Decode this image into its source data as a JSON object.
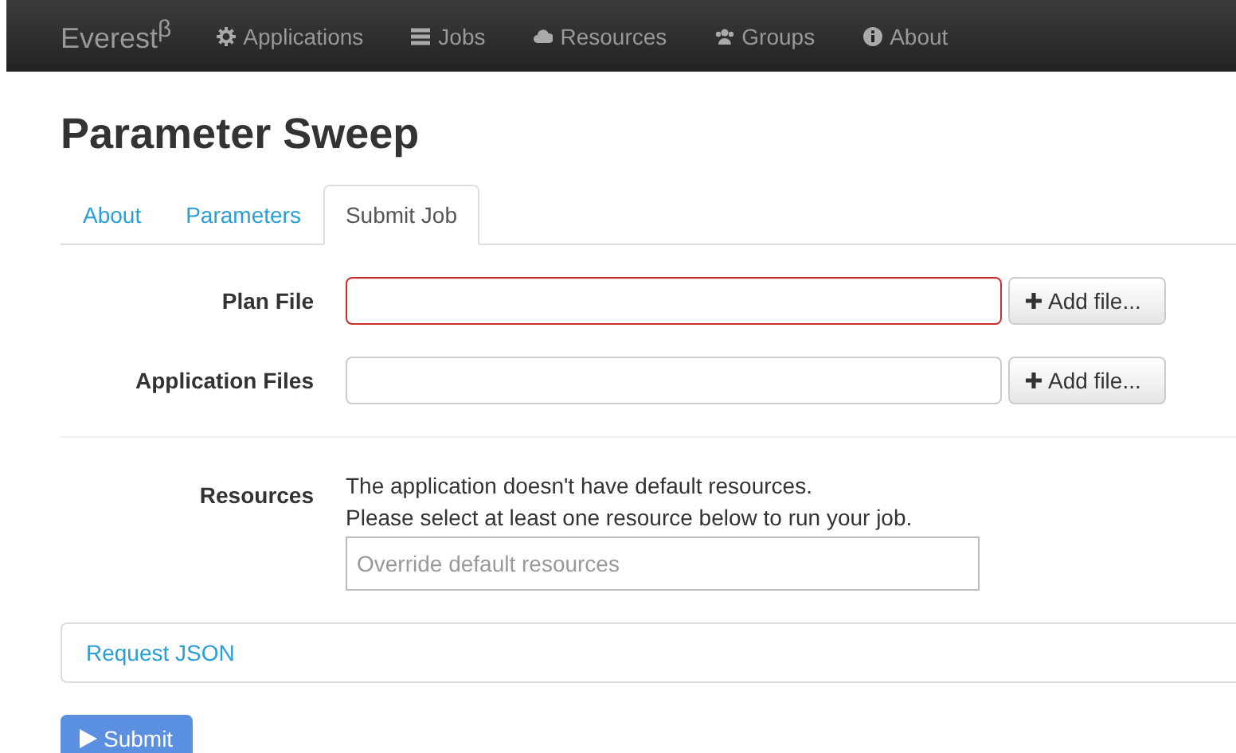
{
  "navbar": {
    "brand": "Everest$^{β}$",
    "items": [
      {
        "kind": "gear",
        "label": "Applications"
      },
      {
        "kind": "list",
        "label": "Jobs"
      },
      {
        "kind": "cloud",
        "label": "Resources"
      },
      {
        "kind": "users",
        "label": "Groups"
      },
      {
        "kind": "info",
        "label": "About"
      }
    ]
  },
  "title": "Parameter Sweep",
  "tabs": [
    {
      "label": "About",
      "selected": false
    },
    {
      "label": "Parameters",
      "selected": false
    },
    {
      "label": "Submit Job",
      "selected": true
    }
  ],
  "files": [
    {
      "label": "Plan File",
      "invalid": true,
      "button": "Add file..."
    },
    {
      "label": "Application Files",
      "invalid": false,
      "button": "Add file..."
    }
  ],
  "resources": {
    "label": "Resources",
    "notes": [
      "The application doesn't have default resources.",
      "Please select at least one resource below to run your job."
    ],
    "placeholder": "Override default resources"
  },
  "request_json": "Request JSON",
  "submit": {
    "label": "Submit",
    "disabled": true
  }
}
